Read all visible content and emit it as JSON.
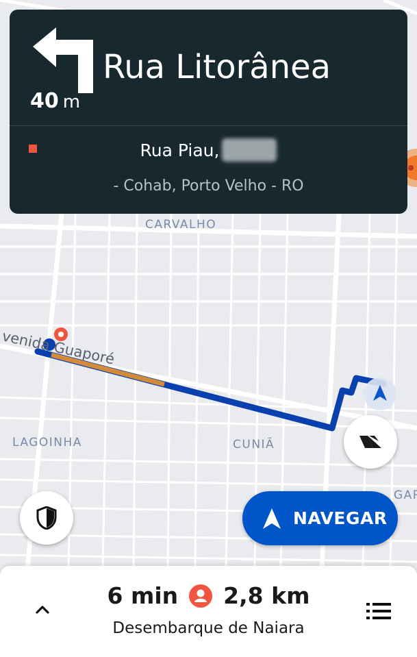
{
  "colors": {
    "card_bg": "#18282f",
    "accent_blue": "#0055c8",
    "route_blue": "#0a3fae",
    "route_traffic": "#d38a3a",
    "destination_red": "#f2553f",
    "map_bg": "#e9ebee"
  },
  "maneuver": {
    "icon": "turn-left-arrow-icon",
    "distance_value": "40",
    "distance_unit": "m",
    "street": "Rua Litorânea"
  },
  "destination": {
    "marker_icon": "destination-square-icon",
    "line1": "Rua Piau,",
    "line2": "- Cohab, Porto Velho - RO"
  },
  "map": {
    "labels": {
      "carvalho": "CARVALHO",
      "avenue": "venida Guaporé",
      "lagoinha": "LAGOINHA",
      "cunia": "CUNIÃ",
      "partial_right": "GAR"
    }
  },
  "buttons": {
    "navigate_label": "NAVEGAR",
    "recenter_icon": "overview-route-icon",
    "safety_icon": "shield-icon"
  },
  "trip": {
    "duration": "6 min",
    "distance": "2,8 km",
    "passenger_icon": "person-icon",
    "subtitle": "Desembarque de Naiara"
  }
}
